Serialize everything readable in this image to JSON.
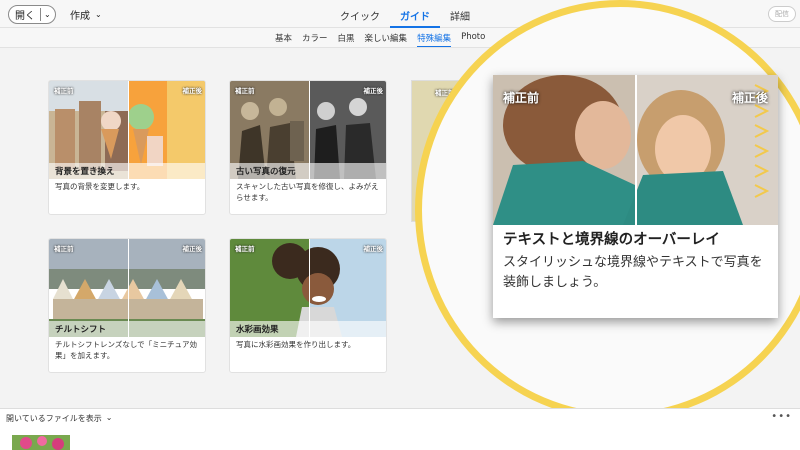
{
  "toolbar": {
    "open_label": "開く",
    "create_label": "作成",
    "share_label": "配信",
    "modes": [
      {
        "label": "クイック",
        "active": false
      },
      {
        "label": "ガイド",
        "active": true
      },
      {
        "label": "詳細",
        "active": false
      }
    ]
  },
  "subtabs": [
    {
      "label": "基本",
      "active": false
    },
    {
      "label": "カラー",
      "active": false
    },
    {
      "label": "白黒",
      "active": false
    },
    {
      "label": "楽しい編集",
      "active": false
    },
    {
      "label": "特殊編集",
      "active": true
    },
    {
      "label": "Photo",
      "active": false
    }
  ],
  "cards": [
    {
      "title": "背景を置き換え",
      "desc": "写真の背景を変更します。",
      "before": "補正前",
      "after": "補正後"
    },
    {
      "title": "古い写真の復元",
      "desc": "スキャンした古い写真を修復し、よみがえらせます。",
      "before": "補正前",
      "after": "補正後"
    },
    {
      "title": "チルトシフト",
      "desc": "チルトシフトレンズなしで「ミニチュア効果」を加えます。",
      "before": "補正前",
      "after": "補正後"
    },
    {
      "title": "水彩画効果",
      "desc": "写真に水彩画効果を作り出します。",
      "before": "補正前",
      "after": "補正後"
    }
  ],
  "partial_card": {
    "before": "補正前"
  },
  "zoom": {
    "before": "補正前",
    "after": "補正後",
    "title": "テキストと境界線のオーバーレイ",
    "desc": "スタイリッシュな境界線やテキストで写真を装飾しましょう。"
  },
  "bottom": {
    "show_files_label": "開いているファイルを表示",
    "more": "•••"
  },
  "colors": {
    "accent": "#1473e6",
    "highlight_ring": "#f6d351"
  }
}
